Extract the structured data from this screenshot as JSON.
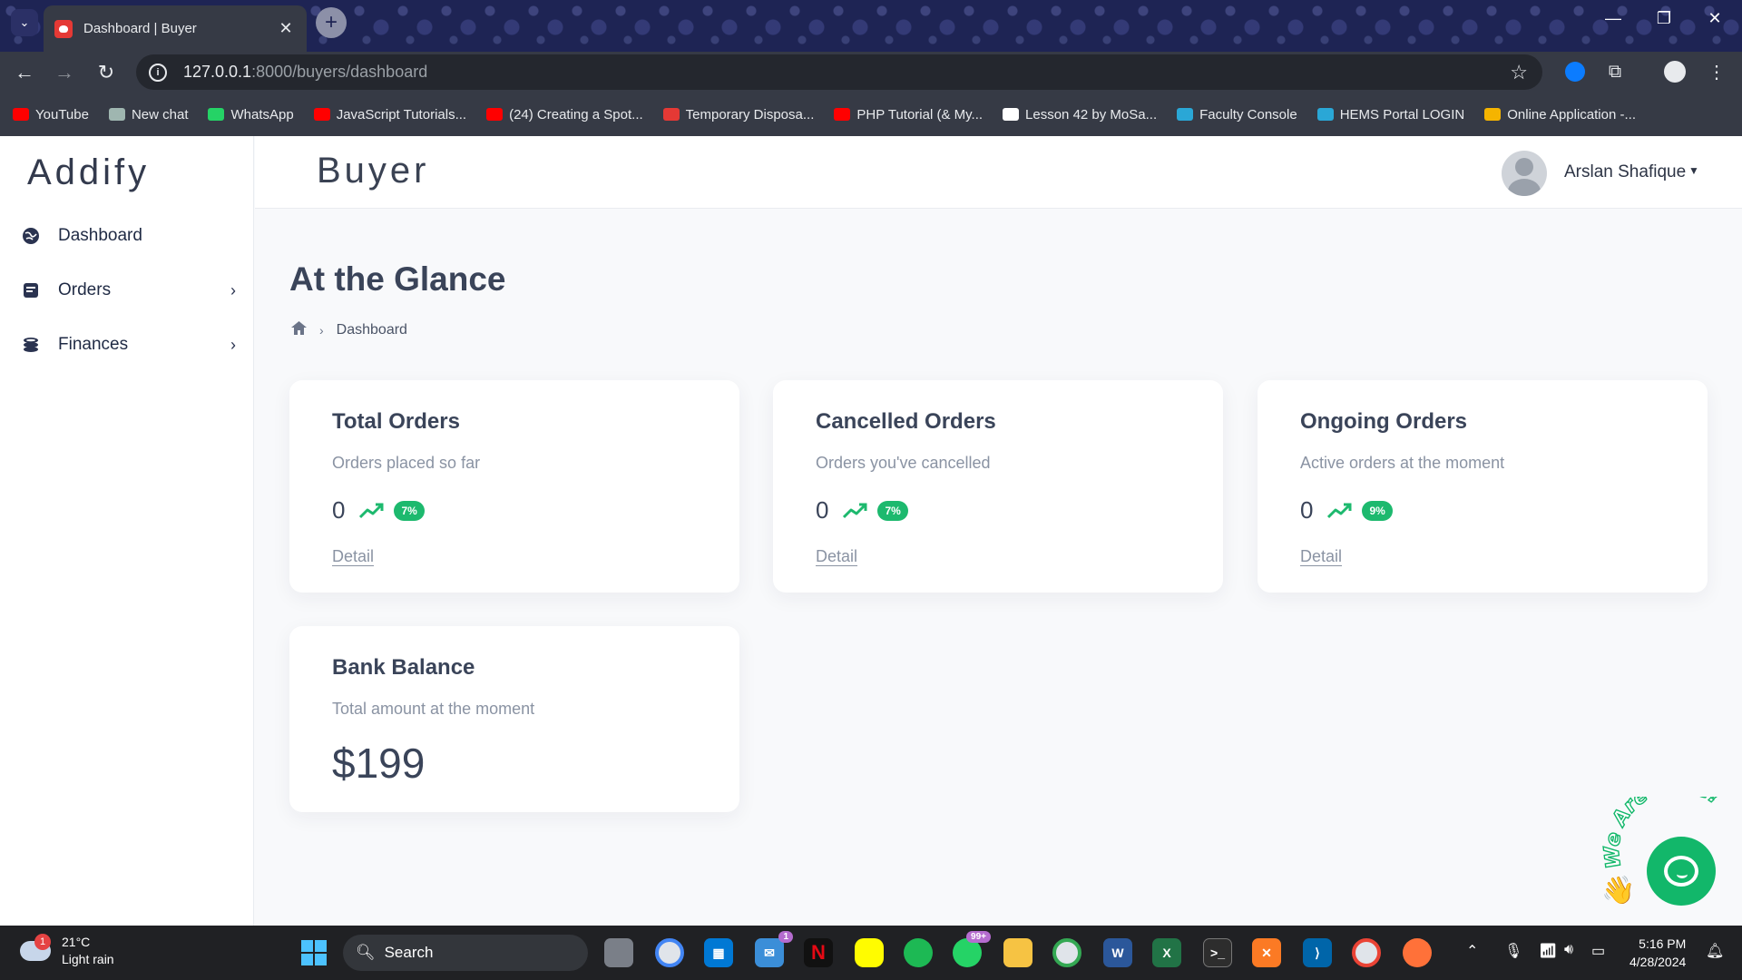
{
  "browser": {
    "tab_title": "Dashboard | Buyer",
    "url_host": "127.0.0.1",
    "url_path": ":8000/buyers/dashboard",
    "bookmarks": [
      {
        "label": "YouTube",
        "color": "#ff0000"
      },
      {
        "label": "New chat",
        "color": "#9fb6b0"
      },
      {
        "label": "WhatsApp",
        "color": "#25d366"
      },
      {
        "label": "JavaScript Tutorials...",
        "color": "#ff0000"
      },
      {
        "label": "(24) Creating a Spot...",
        "color": "#ff0000"
      },
      {
        "label": "Temporary Disposa...",
        "color": "#e53935"
      },
      {
        "label": "PHP Tutorial (& My...",
        "color": "#ff0000"
      },
      {
        "label": "Lesson 42 by MoSa...",
        "color": "#ffffff"
      },
      {
        "label": "Faculty Console",
        "color": "#2aa7d6"
      },
      {
        "label": "HEMS Portal LOGIN",
        "color": "#2aa7d6"
      },
      {
        "label": "Online Application -...",
        "color": "#f5b400"
      }
    ]
  },
  "app": {
    "brand": "Addify",
    "header_title": "Buyer",
    "user_name": "Arslan Shafique"
  },
  "sidebar": {
    "items": [
      {
        "label": "Dashboard",
        "icon": "globe-icon"
      },
      {
        "label": "Orders",
        "icon": "receipt-icon"
      },
      {
        "label": "Finances",
        "icon": "coins-icon"
      }
    ]
  },
  "page": {
    "title": "At the Glance",
    "breadcrumb": "Dashboard"
  },
  "cards": [
    {
      "title": "Total Orders",
      "subtitle": "Orders placed so far",
      "value": "0",
      "badge": "7%",
      "link": "Detail"
    },
    {
      "title": "Cancelled Orders",
      "subtitle": "Orders you've cancelled",
      "value": "0",
      "badge": "7%",
      "link": "Detail"
    },
    {
      "title": "Ongoing Orders",
      "subtitle": "Active orders at the moment",
      "value": "0",
      "badge": "9%",
      "link": "Detail"
    }
  ],
  "balance_card": {
    "title": "Bank Balance",
    "subtitle": "Total amount at the moment",
    "value": "$199"
  },
  "chat_widget": {
    "label": "We Are Here!"
  },
  "taskbar": {
    "weather_temp": "21°C",
    "weather_desc": "Light rain",
    "weather_badge": "1",
    "search_label": "Search",
    "mail_badge": "1",
    "whatsapp_badge": "99+",
    "time": "5:16 PM",
    "date": "4/28/2024"
  },
  "colors": {
    "accent_green": "#1db96e",
    "chat_green": "#12b76a",
    "text_dark": "#3a4459"
  }
}
